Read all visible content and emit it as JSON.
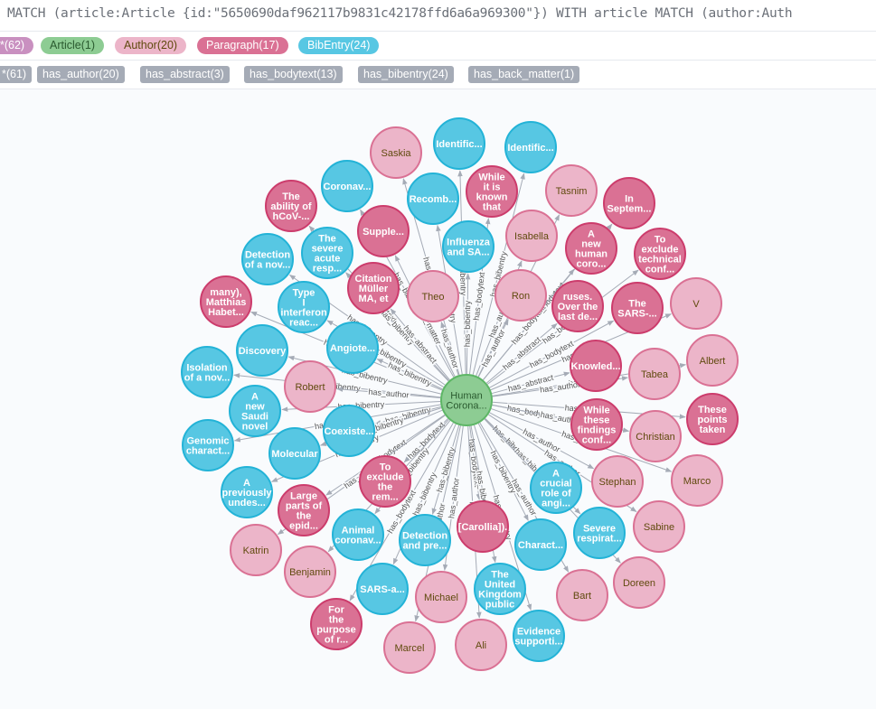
{
  "query": {
    "text": "MATCH (article:Article {id:\"5650690daf962117b9831c42178ffd6a6a969300\"}) WITH article MATCH (author:Auth"
  },
  "node_labels": [
    {
      "label": "*(62)",
      "color": "#c990c0",
      "text_color": "#ffffff"
    },
    {
      "label": "Article(1)",
      "color": "#8dcc93",
      "text_color": "#2a5a2f"
    },
    {
      "label": "Author(20)",
      "color": "#ecb5c9",
      "text_color": "#604a0e"
    },
    {
      "label": "Paragraph(17)",
      "color": "#da7194",
      "text_color": "#ffffff"
    },
    {
      "label": "BibEntry(24)",
      "color": "#57c7e3",
      "text_color": "#ffffff"
    }
  ],
  "relationship_types": [
    {
      "label": "*(61)"
    },
    {
      "label": "has_author(20)"
    },
    {
      "label": "has_abstract(3)"
    },
    {
      "label": "has_bodytext(13)"
    },
    {
      "label": "has_bibentry(24)"
    },
    {
      "label": "has_back_matter(1)"
    }
  ],
  "node_styles": {
    "Article": {
      "fill": "#8dcc93",
      "stroke": "#5db665",
      "text": "#2a5a2f"
    },
    "Author": {
      "fill": "#ecb5c9",
      "stroke": "#da7194",
      "text": "#604a0e"
    },
    "Paragraph": {
      "fill": "#da7194",
      "stroke": "#cc3c6c",
      "text": "#ffffff"
    },
    "BibEntry": {
      "fill": "#57c7e3",
      "stroke": "#23b3d7",
      "text": "#ffffff"
    }
  },
  "graph": {
    "center": {
      "id": "article",
      "type": "Article",
      "lines": [
        "Human",
        "Corona..."
      ]
    },
    "nodes": [
      {
        "id": "saskia",
        "type": "Author",
        "lines": [
          "Saskia"
        ],
        "rel": "has_author"
      },
      {
        "id": "identific1",
        "type": "BibEntry",
        "lines": [
          "Identific..."
        ],
        "rel": "has_bibentry"
      },
      {
        "id": "identific2",
        "type": "BibEntry",
        "lines": [
          "Identific..."
        ],
        "rel": "has_bibentry"
      },
      {
        "id": "coronav1",
        "type": "BibEntry",
        "lines": [
          "Coronav..."
        ],
        "rel": "has_bibentry"
      },
      {
        "id": "recomb",
        "type": "BibEntry",
        "lines": [
          "Recomb..."
        ],
        "rel": "has_bibentry"
      },
      {
        "id": "whileknown",
        "type": "Paragraph",
        "lines": [
          "While",
          "it is",
          "known",
          "that"
        ],
        "rel": "has_bodytext"
      },
      {
        "id": "tasnim",
        "type": "Author",
        "lines": [
          "Tasnim"
        ],
        "rel": "has_author"
      },
      {
        "id": "ability",
        "type": "Paragraph",
        "lines": [
          "The",
          "ability of",
          "hCoV-..."
        ],
        "rel": "has_bodytext"
      },
      {
        "id": "insept",
        "type": "Paragraph",
        "lines": [
          "In",
          "Septem..."
        ],
        "rel": "has_bodytext"
      },
      {
        "id": "supple",
        "type": "Paragraph",
        "lines": [
          "Supple..."
        ],
        "rel": "has_back_matter"
      },
      {
        "id": "influenza",
        "type": "BibEntry",
        "lines": [
          "Influenza",
          "and SA..."
        ],
        "rel": "has_bibentry"
      },
      {
        "id": "isabella",
        "type": "Author",
        "lines": [
          "Isabella"
        ],
        "rel": "has_author"
      },
      {
        "id": "newhuman",
        "type": "Paragraph",
        "lines": [
          "A",
          "new",
          "human",
          "coro..."
        ],
        "rel": "has_bodytext"
      },
      {
        "id": "toexclude1",
        "type": "Paragraph",
        "lines": [
          "To",
          "exclude",
          "technical",
          "conf..."
        ],
        "rel": "has_bodytext"
      },
      {
        "id": "detection1",
        "type": "BibEntry",
        "lines": [
          "Detection",
          "of a nov..."
        ],
        "rel": "has_bibentry"
      },
      {
        "id": "severe1",
        "type": "BibEntry",
        "lines": [
          "The",
          "severe",
          "acute",
          "resp..."
        ],
        "rel": "has_bibentry"
      },
      {
        "id": "citation",
        "type": "Paragraph",
        "lines": [
          "Citation",
          "Müller",
          "MA, et"
        ],
        "rel": "has_abstract"
      },
      {
        "id": "theo",
        "type": "Author",
        "lines": [
          "Theo"
        ],
        "rel": "has_author"
      },
      {
        "id": "ron",
        "type": "Author",
        "lines": [
          "Ron"
        ],
        "rel": "has_author"
      },
      {
        "id": "ruses",
        "type": "Paragraph",
        "lines": [
          "ruses.",
          "Over the",
          "last de..."
        ],
        "rel": "has_abstract"
      },
      {
        "id": "sars1",
        "type": "Paragraph",
        "lines": [
          "The",
          "SARS-..."
        ],
        "rel": "has_bodytext"
      },
      {
        "id": "v",
        "type": "Author",
        "lines": [
          "V"
        ],
        "rel": "has_author"
      },
      {
        "id": "matthias",
        "type": "Paragraph",
        "lines": [
          "many),",
          "Matthias",
          "Habet..."
        ],
        "rel": "has_bodytext"
      },
      {
        "id": "typei",
        "type": "BibEntry",
        "lines": [
          "Type",
          "I",
          "interferon",
          "reac..."
        ],
        "rel": "has_bibentry"
      },
      {
        "id": "angiote",
        "type": "BibEntry",
        "lines": [
          "Angiote..."
        ],
        "rel": "has_bibentry"
      },
      {
        "id": "discovery",
        "type": "BibEntry",
        "lines": [
          "Discovery"
        ],
        "rel": "has_bibentry"
      },
      {
        "id": "albert",
        "type": "Author",
        "lines": [
          "Albert"
        ],
        "rel": "has_author"
      },
      {
        "id": "knowled",
        "type": "Paragraph",
        "lines": [
          "Knowled..."
        ],
        "rel": "has_abstract"
      },
      {
        "id": "tabea",
        "type": "Author",
        "lines": [
          "Tabea"
        ],
        "rel": "has_author"
      },
      {
        "id": "isolation",
        "type": "BibEntry",
        "lines": [
          "Isolation",
          "of a nov..."
        ],
        "rel": "has_bibentry"
      },
      {
        "id": "robert",
        "type": "Author",
        "lines": [
          "Robert"
        ],
        "rel": "has_author"
      },
      {
        "id": "saudi",
        "type": "BibEntry",
        "lines": [
          "A",
          "new",
          "Saudi",
          "novel"
        ],
        "rel": "has_bibentry"
      },
      {
        "id": "thesepoints",
        "type": "Paragraph",
        "lines": [
          "These",
          "points",
          "taken"
        ],
        "rel": "has_bodytext"
      },
      {
        "id": "whilefindings",
        "type": "Paragraph",
        "lines": [
          "While",
          "these",
          "findings",
          "conf..."
        ],
        "rel": "has_bodytext"
      },
      {
        "id": "christian",
        "type": "Author",
        "lines": [
          "Christian"
        ],
        "rel": "has_author"
      },
      {
        "id": "coexiste",
        "type": "BibEntry",
        "lines": [
          "Coexiste..."
        ],
        "rel": "has_bibentry"
      },
      {
        "id": "genomic",
        "type": "BibEntry",
        "lines": [
          "Genomic",
          "charact..."
        ],
        "rel": "has_bibentry"
      },
      {
        "id": "molecular",
        "type": "BibEntry",
        "lines": [
          "Molecular"
        ],
        "rel": "has_bibentry"
      },
      {
        "id": "marco",
        "type": "Author",
        "lines": [
          "Marco"
        ],
        "rel": "has_author"
      },
      {
        "id": "toexclude2",
        "type": "Paragraph",
        "lines": [
          "To",
          "exclude",
          "the",
          "rem..."
        ],
        "rel": "has_bodytext"
      },
      {
        "id": "crucial",
        "type": "BibEntry",
        "lines": [
          "A",
          "crucial",
          "role of",
          "angi..."
        ],
        "rel": "has_bibentry"
      },
      {
        "id": "stephan",
        "type": "Author",
        "lines": [
          "Stephan"
        ],
        "rel": "has_author"
      },
      {
        "id": "previously",
        "type": "BibEntry",
        "lines": [
          "A",
          "previously",
          "undes..."
        ],
        "rel": "has_bibentry"
      },
      {
        "id": "largeparts",
        "type": "Paragraph",
        "lines": [
          "Large",
          "parts of",
          "the",
          "epid..."
        ],
        "rel": "has_bodytext"
      },
      {
        "id": "carollia",
        "type": "Paragraph",
        "lines": [
          "[Carollia])."
        ],
        "rel": "has_bodytext"
      },
      {
        "id": "sabine",
        "type": "Author",
        "lines": [
          "Sabine"
        ],
        "rel": "has_author"
      },
      {
        "id": "animal",
        "type": "BibEntry",
        "lines": [
          "Animal",
          "coronav..."
        ],
        "rel": "has_bibentry"
      },
      {
        "id": "detection2",
        "type": "BibEntry",
        "lines": [
          "Detection",
          "and pre..."
        ],
        "rel": "has_bibentry"
      },
      {
        "id": "charact",
        "type": "BibEntry",
        "lines": [
          "Charact..."
        ],
        "rel": "has_bibentry"
      },
      {
        "id": "severe2",
        "type": "BibEntry",
        "lines": [
          "Severe",
          "respirat..."
        ],
        "rel": "has_bibentry"
      },
      {
        "id": "katrin",
        "type": "Author",
        "lines": [
          "Katrin"
        ],
        "rel": "has_author"
      },
      {
        "id": "benjamin",
        "type": "Author",
        "lines": [
          "Benjamin"
        ],
        "rel": "has_author"
      },
      {
        "id": "doreen",
        "type": "Author",
        "lines": [
          "Doreen"
        ],
        "rel": "has_author"
      },
      {
        "id": "sarsa",
        "type": "BibEntry",
        "lines": [
          "SARS-a..."
        ],
        "rel": "has_bibentry"
      },
      {
        "id": "ukpublic",
        "type": "BibEntry",
        "lines": [
          "The",
          "United",
          "Kingdom",
          "public"
        ],
        "rel": "has_bibentry"
      },
      {
        "id": "michael",
        "type": "Author",
        "lines": [
          "Michael"
        ],
        "rel": "has_author"
      },
      {
        "id": "bart",
        "type": "Author",
        "lines": [
          "Bart"
        ],
        "rel": "has_author"
      },
      {
        "id": "forpurpose",
        "type": "Paragraph",
        "lines": [
          "For",
          "the",
          "purpose",
          "of r..."
        ],
        "rel": "has_bodytext"
      },
      {
        "id": "evidence",
        "type": "BibEntry",
        "lines": [
          "Evidence",
          "supporti..."
        ],
        "rel": "has_bibentry"
      },
      {
        "id": "marcel",
        "type": "Author",
        "lines": [
          "Marcel"
        ],
        "rel": "has_author"
      },
      {
        "id": "ali",
        "type": "Author",
        "lines": [
          "Ali"
        ],
        "rel": "has_author"
      }
    ]
  }
}
